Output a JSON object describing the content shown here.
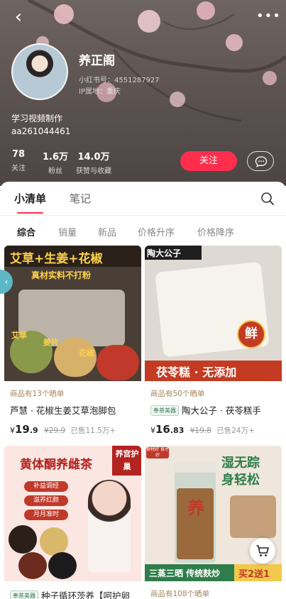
{
  "profile": {
    "name": "养正阁",
    "red_id": "小红书号：4551287927",
    "ip_location": "IP属地：重庆",
    "bio_line1": "学习视频制作",
    "bio_line2": "aa261044461",
    "stats": [
      {
        "num": "78",
        "label": "关注"
      },
      {
        "num": "1.6万",
        "label": "粉丝"
      },
      {
        "num": "14.0万",
        "label": "获赞与收藏"
      }
    ],
    "follow_label": "关注"
  },
  "tabs": [
    {
      "label": "小清单",
      "active": true
    },
    {
      "label": "笔记",
      "active": false
    }
  ],
  "sort": [
    {
      "label": "综合",
      "active": true
    },
    {
      "label": "销量",
      "active": false
    },
    {
      "label": "新品",
      "active": false
    },
    {
      "label": "价格升序",
      "active": false
    },
    {
      "label": "价格降序",
      "active": false
    }
  ],
  "products": [
    {
      "image_text": {
        "headline": "艾草+生姜+花椒",
        "sub": "真材实料不打粉",
        "tag1": "艾草",
        "tag2": "姜片",
        "tag3": "花椒"
      },
      "reviews": "商品有13个晒单",
      "badge": "",
      "title": "芦慧 · 花椒生姜艾草泡脚包",
      "price_int": "19",
      "price_dec": ".9",
      "price_orig": "¥29.9",
      "sold": "已售11.5万+"
    },
    {
      "image_text": {
        "brand": "陶大公子",
        "seal": "鲜",
        "caption": "茯苓糕 · 无添加"
      },
      "reviews": "商品有50个晒单",
      "badge": "奉茶美器",
      "title": "陶大公子 · 茯苓糕手",
      "price_int": "16",
      "price_dec": ".83",
      "price_orig": "¥19.8",
      "sold": "已售24万+"
    },
    {
      "image_text": {
        "headline": "黄体酮养雌茶",
        "corner_tag": "养宫护巢",
        "bullets": [
          "补益调经",
          "滋养红颜",
          "月月准时"
        ]
      },
      "reviews": "",
      "badge": "奉茶美器",
      "title": "种子循环茨养【呵护卵",
      "price_int": "",
      "price_dec": "",
      "price_orig": "",
      "sold": ""
    },
    {
      "image_text": {
        "headline_1": "湿无踪",
        "headline_2": "身轻松",
        "jar_label": "养",
        "corner_brand": "食材好 食才好",
        "footer": "三蒸三晒 传统麸炒",
        "promo": "买2送1"
      },
      "reviews": "商品有108个晒单",
      "badge": "",
      "title": "",
      "price_int": "",
      "price_dec": "",
      "price_orig": "",
      "sold": ""
    }
  ],
  "currency": "¥",
  "colors": {
    "accent": "#ff2e4d",
    "review": "#a6845a"
  }
}
